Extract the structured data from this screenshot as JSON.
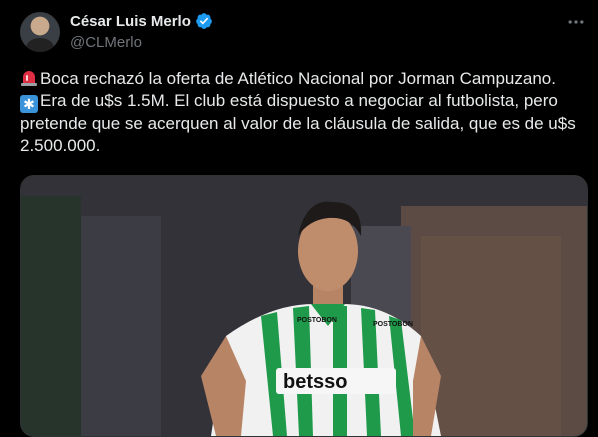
{
  "author": {
    "display_name": "César Luis Merlo",
    "handle": "@CLMerlo",
    "verified": true
  },
  "tweet": {
    "line1": "Boca rechazó la oferta de Atlético Nacional por Jorman Campuzano.",
    "line2": "Era de u$s 1.5M. El club está dispuesto a negociar al futbolista, pero pretende que se acerquen al valor de la cláusula de salida, que es de u$s 2.500.000.",
    "emoji1": "rotating-light-icon",
    "emoji2": "asterisk-icon"
  },
  "media": {
    "jersey_sponsor": "betsso",
    "chest_brand_left": "POSTOBON",
    "chest_brand_right": "POSTOBON"
  },
  "colors": {
    "background": "#000000",
    "text": "#e7e9ea",
    "secondary": "#71767b",
    "verified": "#1d9bf0",
    "jersey_green": "#1f9a4a"
  }
}
